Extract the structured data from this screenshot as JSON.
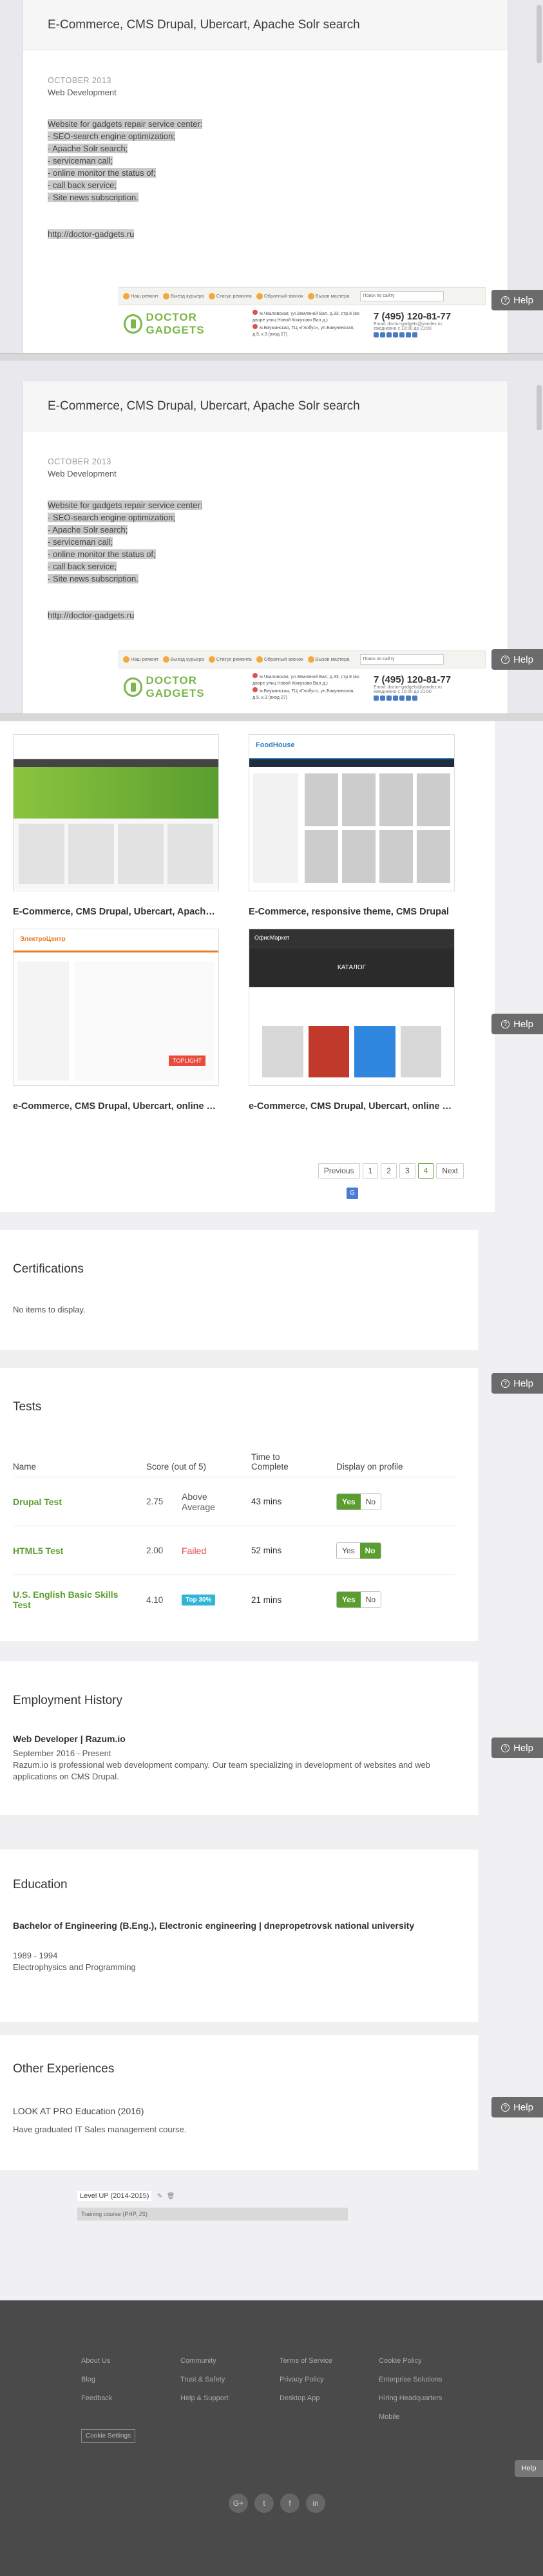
{
  "modal": {
    "title": "E-Commerce, CMS Drupal, Ubercart, Apache Solr search",
    "date": "OCTOBER 2013",
    "category": "Web Development",
    "description": [
      "Website for gadgets repair service center:",
      "- SEO-search engine optimization;",
      "- Apache Solr search;",
      "- serviceman call;",
      "- online monitor the status of;",
      "- call back service;",
      "- Site news subscription."
    ],
    "url": "http://doctor-gadgets.ru",
    "preview": {
      "nav": [
        "Наш ремонт",
        "Выезд курьера",
        "Статус ремонта",
        "Обратный звонок",
        "Вызов мастера"
      ],
      "search_placeholder": "Поиск по сайту",
      "logo": "DOCTOR GADGETS",
      "address1": "м.Чкаловская, ул.Земляной Вал, д.33, стр.8 (во дворе улиц Новой Кожухово Вал д.)",
      "address2": "м.Бауманская, ТЦ «Глобус», ул.Бакунинская, д.5, к.3 (вход 27)",
      "phone": "7 (495) 120-81-77",
      "email": "Email: doctor-gadgets@yandex.ru",
      "hours": "ежедневно с 10:00 до 21:00"
    }
  },
  "help_label": "Help",
  "portfolio": {
    "items": [
      {
        "label": "E-Commerce, CMS Drupal, Ubercart, Apache Solr search"
      },
      {
        "label": "E-Commerce, responsive theme, CMS Drupal"
      },
      {
        "label": "e-Commerce, CMS Drupal, Ubercart, online store"
      },
      {
        "label": "e-Commerce, CMS Drupal, Ubercart, online store"
      }
    ],
    "thumb_texts": {
      "t2_brand": "FoodHouse",
      "t3_brand": "ЭлектроЦентр",
      "t3_badge": "TOPLIGHT",
      "t4_brand": "ОфисМаркет",
      "t4_heading": "КАТАЛОГ"
    },
    "pager": {
      "prev": "Previous",
      "pages": [
        "1",
        "2",
        "3",
        "4"
      ],
      "active": "4",
      "next": "Next"
    }
  },
  "certifications": {
    "title": "Certifications",
    "empty": "No items to display."
  },
  "tests": {
    "title": "Tests",
    "columns": [
      "Name",
      "Score (out of 5)",
      "Time to Complete",
      "Display on profile"
    ],
    "rows": [
      {
        "name": "Drupal Test",
        "score": "2.75",
        "label": "Above Average",
        "time": "43 mins",
        "display": "Yes"
      },
      {
        "name": "HTML5 Test",
        "score": "2.00",
        "label": "Failed",
        "time": "52 mins",
        "display": "No"
      },
      {
        "name": "U.S. English Basic Skills Test",
        "score": "4.10",
        "label": "Top 30%",
        "time": "21 mins",
        "display": "Yes"
      }
    ],
    "yes": "Yes",
    "no": "No"
  },
  "employment": {
    "title": "Employment History",
    "role": "Web Developer | Razum.io",
    "period": "September 2016 - Present",
    "description": "Razum.io is professional web development company. Our team specializing in development of websites and web applications on CMS Drupal."
  },
  "education": {
    "title": "Education",
    "degree": "Bachelor of Engineering (B.Eng.), Electronic engineering | dnepropetrovsk national university",
    "period": "1989 - 1994",
    "field": "Electrophysics and Programming"
  },
  "other": {
    "title": "Other Experiences",
    "item_title": "LOOK AT PRO Education (2016)",
    "item_text": "Have graduated IT Sales management course."
  },
  "levelup": {
    "title": "Level UP (2014-2015)",
    "bar": "Training course (PHP, JS)"
  },
  "footer": {
    "col1": [
      "About Us",
      "Blog",
      "Feedback"
    ],
    "col2": [
      "Community",
      "Trust & Safety",
      "Help & Support"
    ],
    "col3": [
      "Terms of Service",
      "Privacy Policy",
      "Desktop App"
    ],
    "col4": [
      "Cookie Policy",
      "Enterprise Solutions",
      "Hiring Headquarters",
      "Mobile"
    ],
    "cookie_btn": "Cookie Settings",
    "social": [
      "G+",
      "t",
      "f",
      "in"
    ],
    "help": "Help"
  }
}
